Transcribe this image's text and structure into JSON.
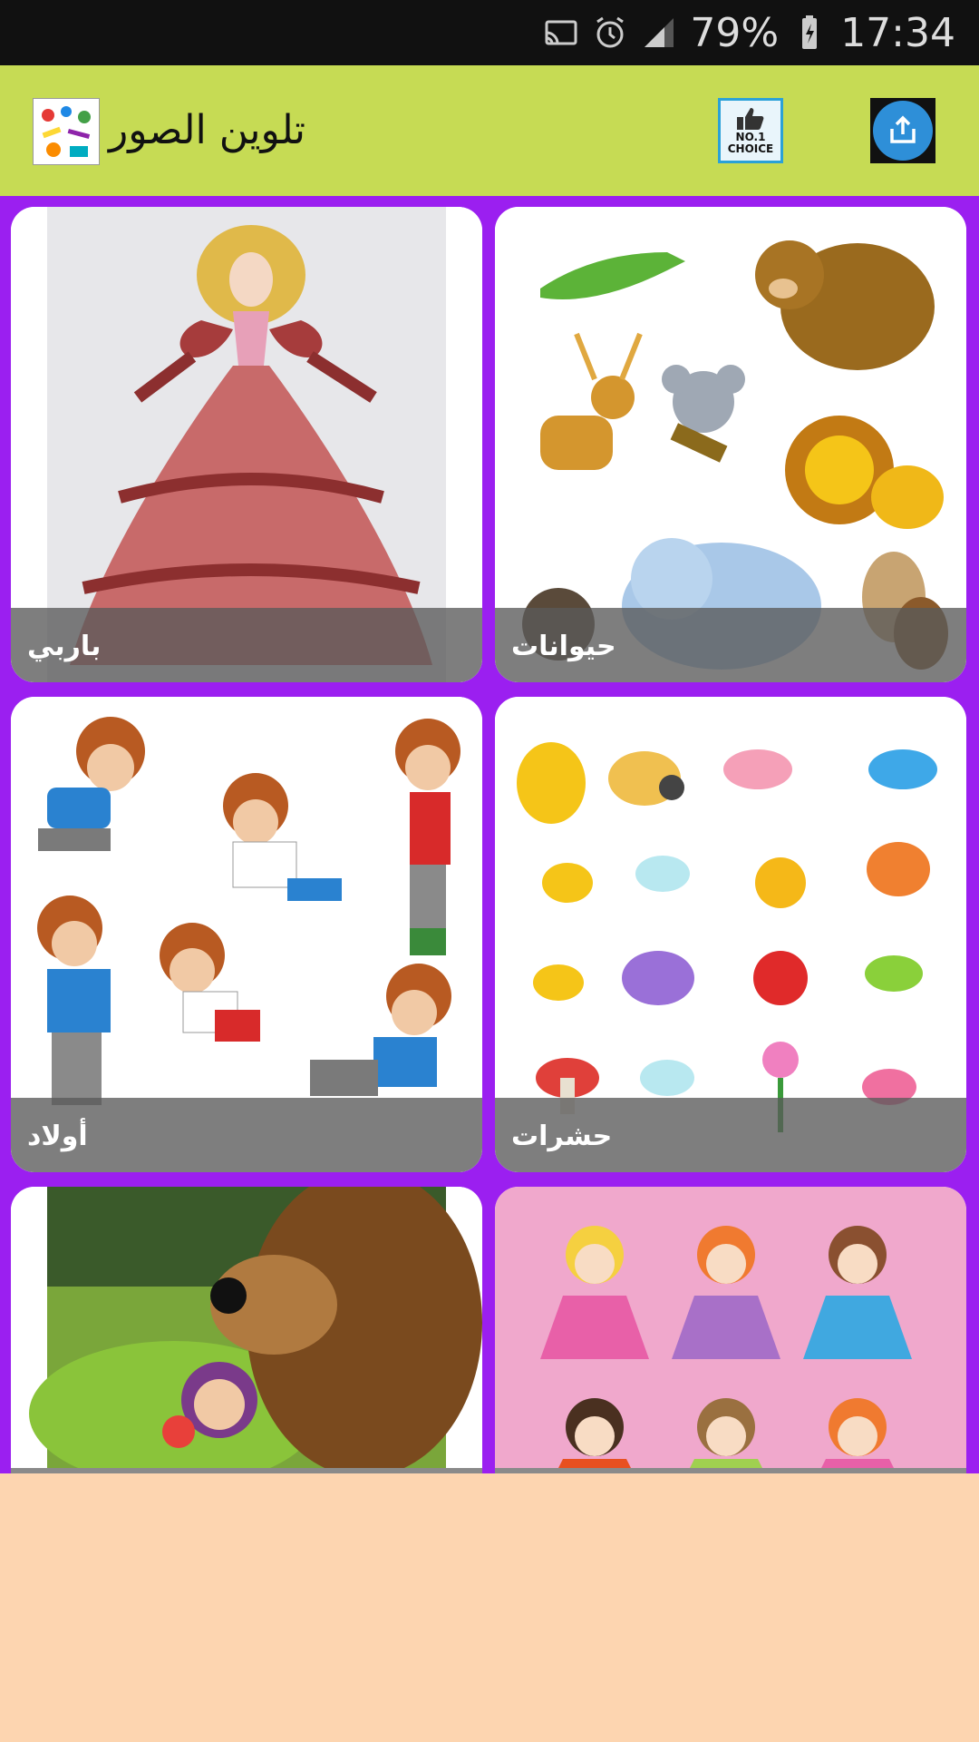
{
  "status_bar": {
    "battery_percent": "79%",
    "time": "17:34",
    "icons": [
      "cast-icon",
      "alarm-icon",
      "signal-icon",
      "battery-icon"
    ]
  },
  "app_bar": {
    "title": "تلوين الصور",
    "choice_badge_line1": "NO.1",
    "choice_badge_line2": "CHOICE",
    "icons": [
      "app-logo-icon",
      "thumbs-up-icon",
      "share-icon"
    ]
  },
  "colors": {
    "app_bar": "#c6db54",
    "grid_background": "#9b1ff0",
    "page_background": "#fdd5b0",
    "share_button": "#2e8fd8"
  },
  "categories": [
    {
      "label": "باربي"
    },
    {
      "label": "حيوانات"
    },
    {
      "label": "أولاد"
    },
    {
      "label": "حشرات"
    },
    {
      "label": ""
    },
    {
      "label": ""
    }
  ]
}
